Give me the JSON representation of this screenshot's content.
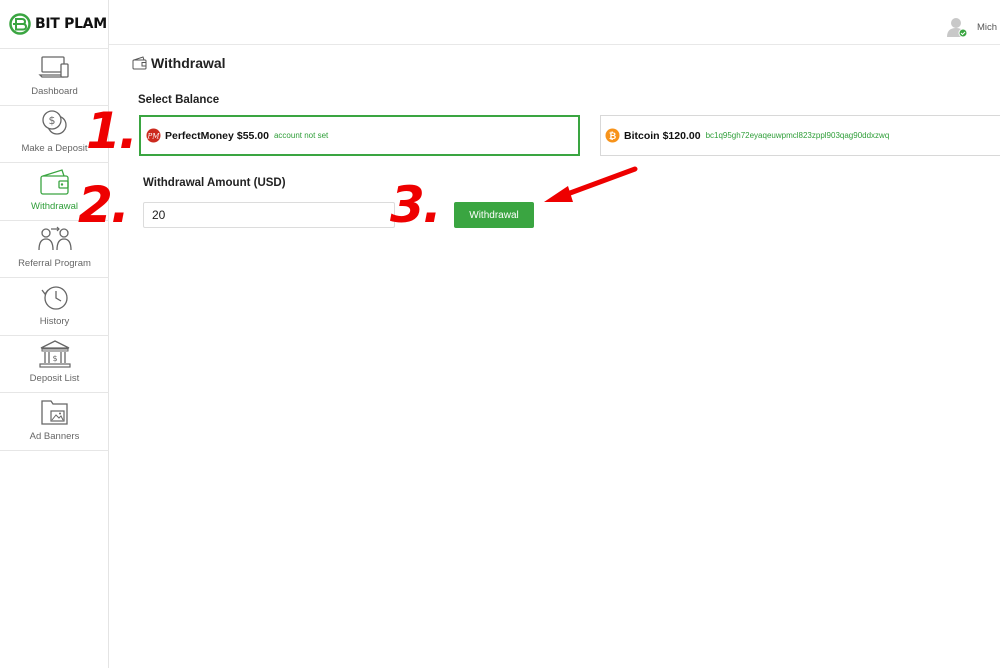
{
  "app": {
    "logo_text": "BIT PLAM"
  },
  "topbar": {
    "user_name": "Mich"
  },
  "sidebar": {
    "items": [
      {
        "label": "Dashboard",
        "icon": "laptop-phone-icon"
      },
      {
        "label": "Make a Deposit",
        "icon": "coins-icon"
      },
      {
        "label": "Withdrawal",
        "icon": "wallet-icon",
        "active": true
      },
      {
        "label": "Referral Program",
        "icon": "people-exchange-icon"
      },
      {
        "label": "History",
        "icon": "history-clock-icon"
      },
      {
        "label": "Deposit List",
        "icon": "bank-icon"
      },
      {
        "label": "Ad Banners",
        "icon": "folder-image-icon"
      }
    ]
  },
  "page": {
    "title": "Withdrawal",
    "select_balance_label": "Select Balance",
    "balances": [
      {
        "name": "PerfectMoney",
        "amount": "$55.00",
        "note": "account not set",
        "selected": true,
        "icon": "perfectmoney-icon"
      },
      {
        "name": "Bitcoin",
        "amount": "$120.00",
        "note": "bc1q95gh72eyaqeuwpmcl823zppl903qag90ddxzwq",
        "selected": false,
        "icon": "bitcoin-icon"
      }
    ],
    "amount_label": "Withdrawal Amount (USD)",
    "amount_value": "20",
    "withdraw_button": "Withdrawal"
  },
  "annotations": {
    "step1": "1.",
    "step2": "2.",
    "step3": "3."
  },
  "colors": {
    "accent": "#3aa541",
    "annotation": "#ee0000"
  }
}
